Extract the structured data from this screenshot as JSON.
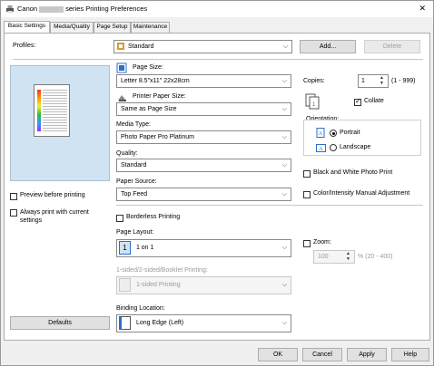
{
  "window": {
    "title_prefix": "Canon",
    "title_suffix": "series Printing Preferences",
    "close_glyph": "✕"
  },
  "tabs": [
    "Basic Settings",
    "Media/Quality",
    "Page Setup",
    "Maintenance"
  ],
  "profiles": {
    "label": "Profiles:",
    "value": "Standard",
    "add_label": "Add...",
    "delete_label": "Delete"
  },
  "left": {
    "preview_before_label": "Preview before printing",
    "always_print_label": "Always print with current settings",
    "defaults_label": "Defaults"
  },
  "page_size": {
    "label": "Page Size:",
    "value": "Letter 8.5\"x11\" 22x28cm"
  },
  "printer_paper_size": {
    "label": "Printer Paper Size:",
    "value": "Same as Page Size"
  },
  "media_type": {
    "label": "Media Type:",
    "value": "Photo Paper Pro Platinum"
  },
  "quality": {
    "label": "Quality:",
    "value": "Standard"
  },
  "paper_source": {
    "label": "Paper Source:",
    "value": "Top Feed"
  },
  "copies": {
    "label": "Copies:",
    "value": "1",
    "range": "(1 - 999)",
    "collate_label": "Collate"
  },
  "orientation": {
    "label": "Orientation:",
    "portrait_label": "Portrait",
    "landscape_label": "Landscape"
  },
  "bw_label": "Black and White Photo Print",
  "color_adj_label": "Color/Intensity Manual Adjustment",
  "borderless_label": "Borderless Printing",
  "page_layout": {
    "label": "Page Layout:",
    "value": "1 on 1",
    "icon_text": "1"
  },
  "zoom": {
    "label": "Zoom:",
    "value": "100",
    "range": "% (20 - 400)"
  },
  "duplex": {
    "label": "1-sided/2-sided/Booklet Printing:",
    "value": "1-sided Printing"
  },
  "binding": {
    "label": "Binding Location:",
    "value": "Long Edge (Left)"
  },
  "footer": {
    "ok": "OK",
    "cancel": "Cancel",
    "apply": "Apply",
    "help": "Help"
  },
  "colors": {
    "accent": "#0060c0",
    "preview_bg": "#cfe3f3"
  }
}
